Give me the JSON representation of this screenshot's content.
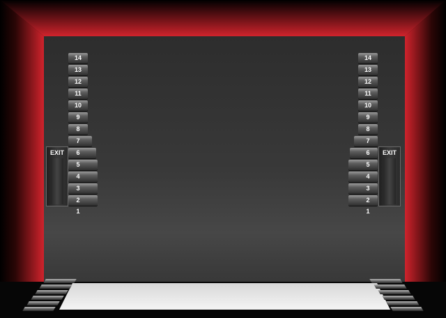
{
  "theater": {
    "left_rows": [
      "14",
      "13",
      "12",
      "11",
      "10",
      "9",
      "8",
      "7",
      "6",
      "5",
      "4",
      "3",
      "2",
      "1"
    ],
    "right_rows": [
      "14",
      "13",
      "12",
      "11",
      "10",
      "9",
      "8",
      "7",
      "6",
      "5",
      "4",
      "3",
      "2",
      "1"
    ],
    "exit_left": "EXIT",
    "exit_right": "EXIT"
  },
  "colors": {
    "curtain": "#d0232c",
    "wall": "#393939",
    "floor": "#f2f2f2"
  }
}
